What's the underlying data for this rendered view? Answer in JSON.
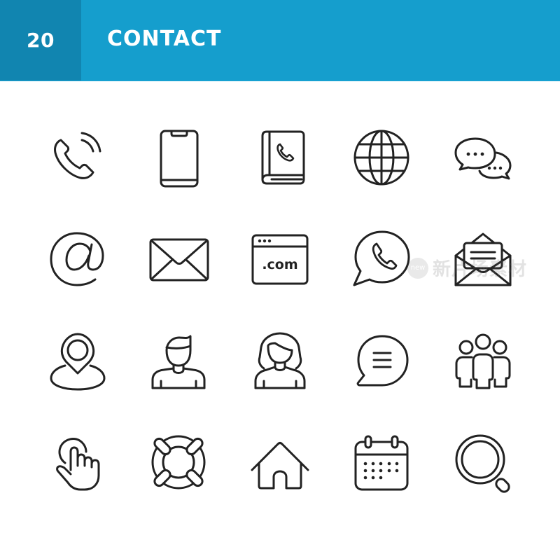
{
  "header": {
    "count": "20",
    "title": "CONTACT",
    "colors": {
      "count_bg": "#1185b0",
      "title_bg": "#159ecd",
      "text": "#ffffff"
    }
  },
  "icon_color": "#222222",
  "icons": [
    {
      "name": "phone-call-icon"
    },
    {
      "name": "smartphone-icon"
    },
    {
      "name": "phone-book-icon"
    },
    {
      "name": "globe-icon"
    },
    {
      "name": "chat-bubbles-icon"
    },
    {
      "name": "at-sign-icon"
    },
    {
      "name": "envelope-icon"
    },
    {
      "name": "website-com-icon",
      "text": ".com"
    },
    {
      "name": "whatsapp-phone-bubble-icon"
    },
    {
      "name": "open-envelope-letter-icon"
    },
    {
      "name": "location-pin-icon"
    },
    {
      "name": "male-user-icon"
    },
    {
      "name": "female-user-icon"
    },
    {
      "name": "message-bubble-icon"
    },
    {
      "name": "team-group-icon"
    },
    {
      "name": "tap-hand-icon"
    },
    {
      "name": "lifebuoy-support-icon"
    },
    {
      "name": "home-icon"
    },
    {
      "name": "calendar-icon"
    },
    {
      "name": "search-magnifier-icon"
    }
  ],
  "watermark": {
    "badge": "new",
    "text": "新片场素材"
  }
}
